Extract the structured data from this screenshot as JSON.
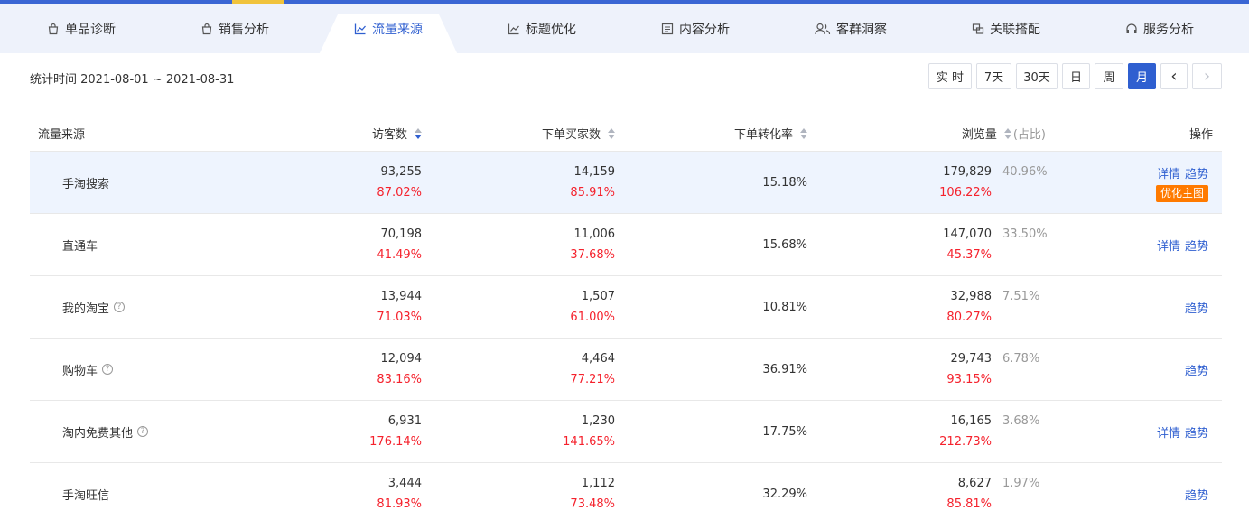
{
  "tabs": [
    {
      "label": "单品诊断",
      "icon": "bag-icon"
    },
    {
      "label": "销售分析",
      "icon": "bag-icon"
    },
    {
      "label": "流量来源",
      "icon": "line-chart-icon",
      "active": true
    },
    {
      "label": "标题优化",
      "icon": "line-chart-icon"
    },
    {
      "label": "内容分析",
      "icon": "document-icon"
    },
    {
      "label": "客群洞察",
      "icon": "users-icon"
    },
    {
      "label": "关联搭配",
      "icon": "link-icon"
    },
    {
      "label": "服务分析",
      "icon": "headset-icon"
    }
  ],
  "stat_time": "统计时间 2021-08-01 ~ 2021-08-31",
  "ranges": [
    {
      "label": "实 时"
    },
    {
      "label": "7天"
    },
    {
      "label": "30天"
    },
    {
      "label": "日"
    },
    {
      "label": "周"
    },
    {
      "label": "月",
      "active": true
    },
    {
      "label": "‹"
    },
    {
      "label": "›",
      "disabled": true
    }
  ],
  "table": {
    "headers": {
      "source": "流量来源",
      "visitors": "访客数",
      "buyers": "下单买家数",
      "conversion": "下单转化率",
      "pageviews": "浏览量",
      "ratio_note": "(占比)",
      "actions": "操作"
    },
    "rows": [
      {
        "source": "手淘搜索",
        "help": false,
        "visitors": "93,255",
        "visitors_pct": "87.02%",
        "buyers": "14,159",
        "buyers_pct": "85.91%",
        "conversion": "15.18%",
        "pageviews": "179,829",
        "pageviews_pct": "106.22%",
        "share": "40.96%",
        "detail": "详情",
        "trend": "趋势",
        "promo": "优化主图",
        "highlight": true
      },
      {
        "source": "直通车",
        "help": false,
        "visitors": "70,198",
        "visitors_pct": "41.49%",
        "buyers": "11,006",
        "buyers_pct": "37.68%",
        "conversion": "15.68%",
        "pageviews": "147,070",
        "pageviews_pct": "45.37%",
        "share": "33.50%",
        "detail": "详情",
        "trend": "趋势"
      },
      {
        "source": "我的淘宝",
        "help": true,
        "visitors": "13,944",
        "visitors_pct": "71.03%",
        "buyers": "1,507",
        "buyers_pct": "61.00%",
        "conversion": "10.81%",
        "pageviews": "32,988",
        "pageviews_pct": "80.27%",
        "share": "7.51%",
        "trend": "趋势"
      },
      {
        "source": "购物车",
        "help": true,
        "visitors": "12,094",
        "visitors_pct": "83.16%",
        "buyers": "4,464",
        "buyers_pct": "77.21%",
        "conversion": "36.91%",
        "pageviews": "29,743",
        "pageviews_pct": "93.15%",
        "share": "6.78%",
        "trend": "趋势"
      },
      {
        "source": "淘内免费其他",
        "help": true,
        "visitors": "6,931",
        "visitors_pct": "176.14%",
        "buyers": "1,230",
        "buyers_pct": "141.65%",
        "conversion": "17.75%",
        "pageviews": "16,165",
        "pageviews_pct": "212.73%",
        "share": "3.68%",
        "detail": "详情",
        "trend": "趋势"
      },
      {
        "source": "手淘旺信",
        "help": false,
        "visitors": "3,444",
        "visitors_pct": "81.93%",
        "buyers": "1,112",
        "buyers_pct": "73.48%",
        "conversion": "32.29%",
        "pageviews": "8,627",
        "pageviews_pct": "85.81%",
        "share": "1.97%",
        "trend": "趋势"
      }
    ]
  }
}
